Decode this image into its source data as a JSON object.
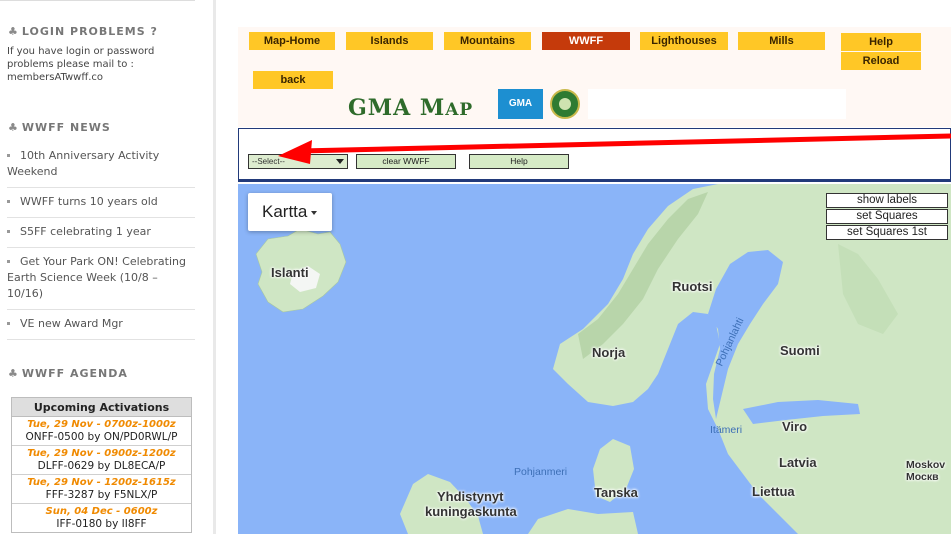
{
  "sidebar": {
    "login": {
      "title": "LOGIN PROBLEMS ?",
      "text": "If you have login or password problems please mail to : membersATwwff.co"
    },
    "news": {
      "title": "WWFF NEWS",
      "items": [
        "10th Anniversary Activity Weekend",
        "WWFF turns 10 years old",
        "S5FF celebrating 1 year",
        "Get Your Park ON! Celebrating Earth Science Week (10/8 – 10/16)",
        "VE new Award Mgr"
      ]
    },
    "agenda": {
      "title": "WWFF AGENDA",
      "table_title": "Upcoming Activations",
      "items": [
        {
          "when": "Tue, 29 Nov - 0700z-1000z",
          "what": "ONFF-0500 by ON/PD0RWL/P"
        },
        {
          "when": "Tue, 29 Nov - 0900z-1200z",
          "what": "DLFF-0629 by DL8ECA/P"
        },
        {
          "when": "Tue, 29 Nov - 1200z-1615z",
          "what": "FFF-3287 by F5NLX/P"
        },
        {
          "when": "Sun, 04 Dec - 0600z",
          "what": "IFF-0180 by II8FF"
        }
      ]
    }
  },
  "nav": {
    "map_home": "Map-Home",
    "islands": "Islands",
    "mountains": "Mountains",
    "wwff": "WWFF",
    "lighthouses": "Lighthouses",
    "mills": "Mills",
    "help": "Help",
    "reload": "Reload",
    "back": "back"
  },
  "logo": {
    "title_big": "GMA M",
    "title_small": "AP",
    "gma_badge": "GMA"
  },
  "toolbar": {
    "select_value": "--Select--",
    "clear_label": "clear WWFF",
    "help_label": "Help"
  },
  "map": {
    "type_label": "Kartta",
    "show_labels": "show labels",
    "set_squares": "set Squares",
    "set_squares_first": "set Squares 1st",
    "labels": {
      "islanti": "Islanti",
      "ruotsi": "Ruotsi",
      "norja": "Norja",
      "suomi": "Suomi",
      "pohjanlahti": "Pohjanlahti",
      "itameri": "Itämeri",
      "viro": "Viro",
      "latvia": "Latvia",
      "liettua": "Liettua",
      "pohjanmeri": "Pohjanmeri",
      "tanska": "Tanska",
      "yhdistynyt1": "Yhdistynyt",
      "yhdistynyt2": "kuningaskunta",
      "moskova1": "Moskov",
      "moskova2": "Москв"
    }
  },
  "colors": {
    "nav_yellow": "#ffc726",
    "nav_active": "#c53a0b",
    "sea": "#8ab4f8",
    "land": "#cfe6c4",
    "arrow": "#ff0000",
    "agenda_time": "#f08a00"
  }
}
